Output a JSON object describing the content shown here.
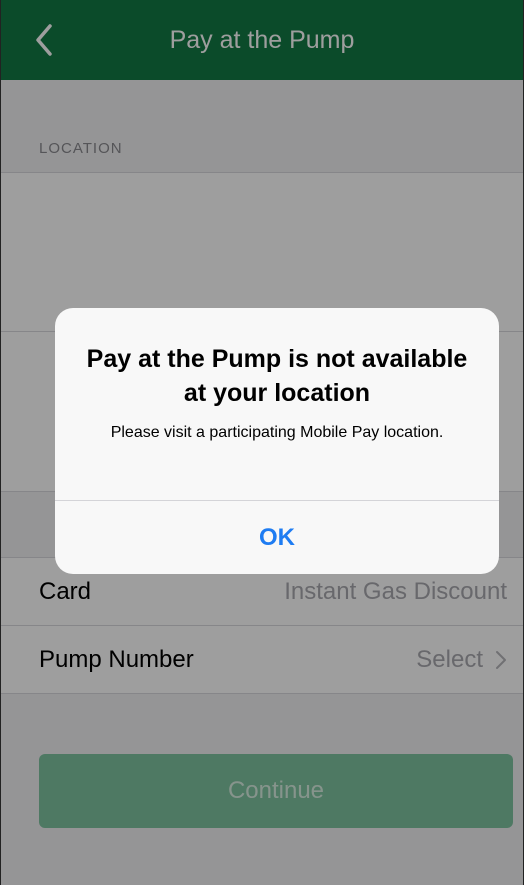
{
  "navbar": {
    "title": "Pay at the Pump",
    "back_icon": "chevron-left-icon",
    "color": "#137a45"
  },
  "location_section": {
    "label": "LOCATION"
  },
  "rows": [
    {
      "label": "Card",
      "value": "Instant Gas Discount"
    },
    {
      "label": "Pump Number",
      "value": "Select",
      "icon": "chevron-right-icon"
    }
  ],
  "continue_button": {
    "label": "Continue",
    "state": "disabled"
  },
  "alert": {
    "title": "Pay at the Pump is not available at your location",
    "message": "Please visit a participating Mobile Pay location.",
    "ok_label": "OK",
    "ok_color": "#1e7cf2"
  }
}
